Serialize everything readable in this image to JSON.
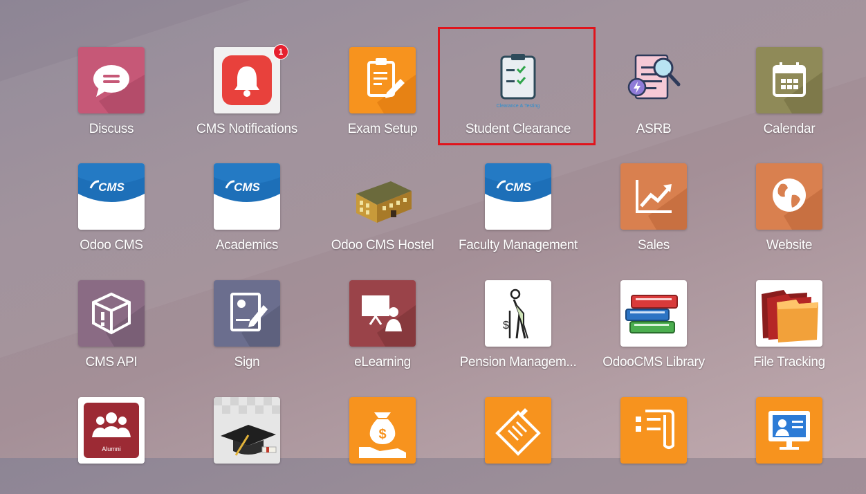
{
  "apps": [
    {
      "label": "Discuss",
      "icon": "chat-bubble-icon"
    },
    {
      "label": "CMS Notifications",
      "icon": "bell-icon",
      "badge": "1"
    },
    {
      "label": "Exam Setup",
      "icon": "clipboard-edit-icon"
    },
    {
      "label": "Student Clearance",
      "icon": "clipboard-check-icon",
      "subcaption": "Clearance & Testing"
    },
    {
      "label": "ASRB",
      "icon": "document-search-icon"
    },
    {
      "label": "Calendar",
      "icon": "calendar-icon"
    },
    {
      "label": "Odoo CMS",
      "icon": "cms-logo-icon",
      "logo_text": "CMS"
    },
    {
      "label": "Academics",
      "icon": "cms-logo-icon",
      "logo_text": "CMS"
    },
    {
      "label": "Odoo CMS Hostel",
      "icon": "building-icon"
    },
    {
      "label": "Faculty Management",
      "icon": "cms-logo-icon",
      "logo_text": "CMS"
    },
    {
      "label": "Sales",
      "icon": "trend-chart-icon"
    },
    {
      "label": "Website",
      "icon": "globe-icon"
    },
    {
      "label": "CMS API",
      "icon": "cube-alert-icon"
    },
    {
      "label": "Sign",
      "icon": "signature-icon"
    },
    {
      "label": "eLearning",
      "icon": "presentation-icon"
    },
    {
      "label": "Pension Managem...",
      "icon": "elderly-person-icon"
    },
    {
      "label": "OdooCMS Library",
      "icon": "books-icon"
    },
    {
      "label": "File Tracking",
      "icon": "folders-icon"
    },
    {
      "label": "",
      "icon": "alumni-icon",
      "logo_text": "Alumni"
    },
    {
      "label": "",
      "icon": "graduation-cap-icon"
    },
    {
      "label": "",
      "icon": "money-hand-icon"
    },
    {
      "label": "",
      "icon": "invoice-edit-icon"
    },
    {
      "label": "",
      "icon": "list-document-icon"
    },
    {
      "label": "",
      "icon": "monitor-profile-icon"
    }
  ],
  "highlighted_app": "Student Clearance",
  "colors": {
    "highlight_border": "#e0141c",
    "badge": "#e6202f",
    "orange_tile": "#f7931e"
  }
}
